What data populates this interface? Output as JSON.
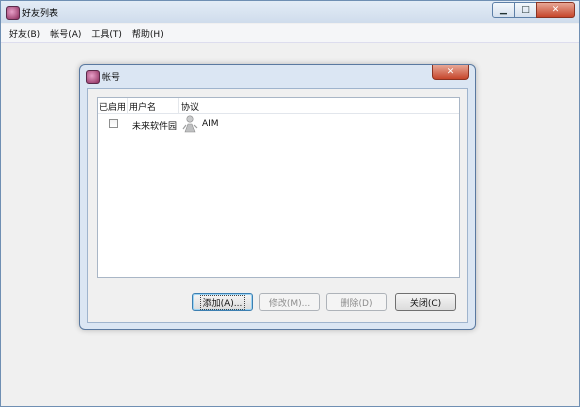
{
  "main_window": {
    "title": "好友列表",
    "caption": {
      "minimize": "▁",
      "maximize": "□",
      "close": "✕"
    }
  },
  "menubar": {
    "items": [
      {
        "label": "好友(B)"
      },
      {
        "label": "帐号(A)"
      },
      {
        "label": "工具(T)"
      },
      {
        "label": "帮助(H)"
      }
    ]
  },
  "dialog": {
    "title": "帐号",
    "close_glyph": "✕",
    "columns": {
      "enabled": "已启用",
      "username": "用户名",
      "protocol": "协议"
    },
    "rows": [
      {
        "enabled": false,
        "username": "未来软件园",
        "protocol": "AIM",
        "protocol_icon": "aim-person-icon"
      }
    ],
    "buttons": {
      "add": "添加(A)...",
      "modify": "修改(M)...",
      "delete": "删除(D)",
      "close": "关闭(C)"
    }
  }
}
